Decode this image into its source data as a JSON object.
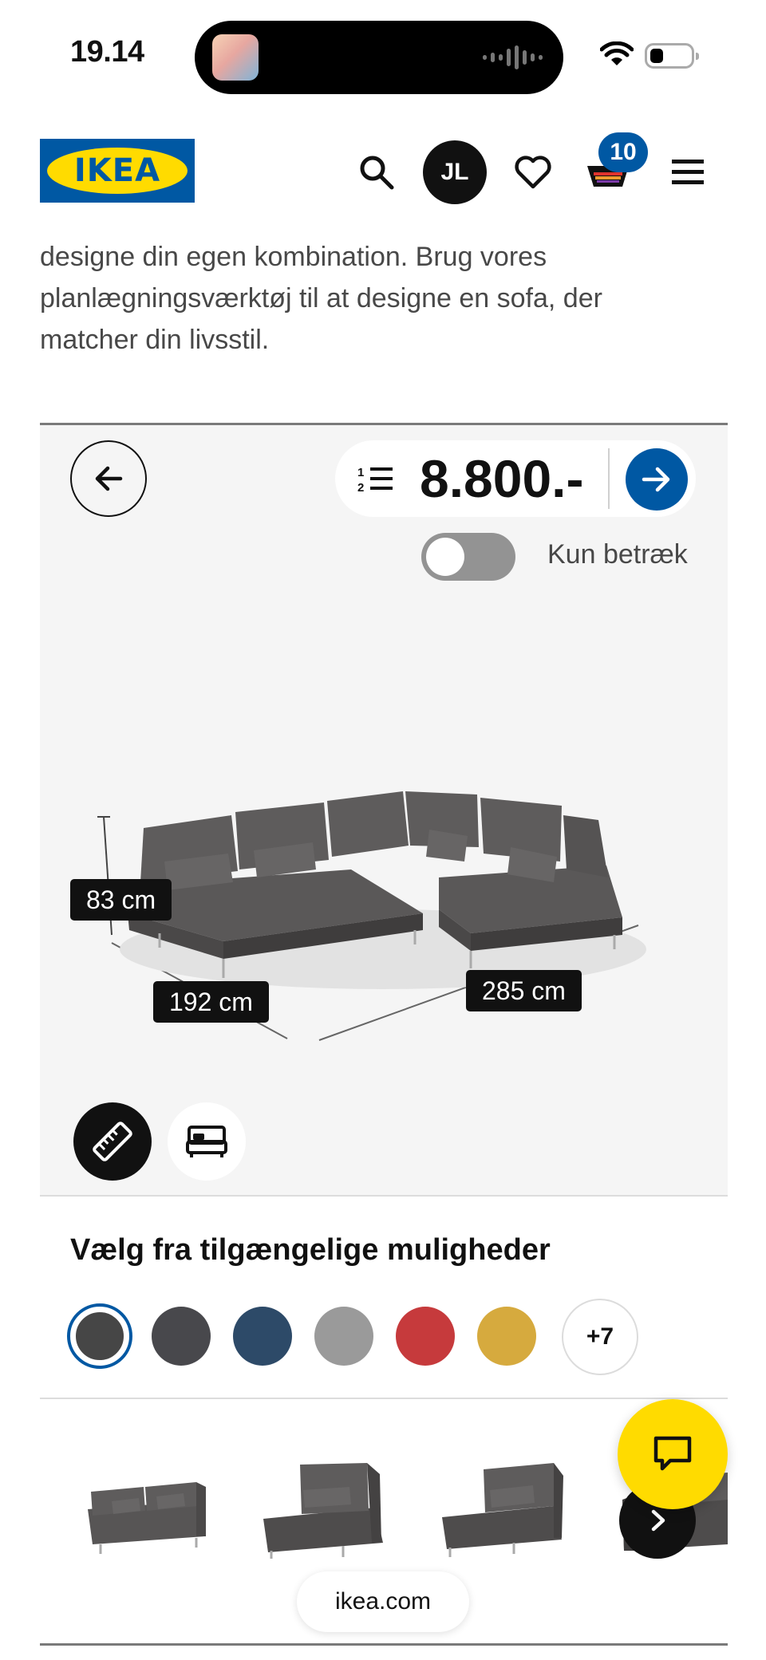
{
  "status_bar": {
    "time": "19.14"
  },
  "header": {
    "logo_text": "IKEA",
    "avatar_initials": "JL",
    "cart_count": "10",
    "brand_colors": {
      "blue": "#0058a3",
      "yellow": "#ffdb00"
    }
  },
  "intro_text": "designe din egen kombination. Brug vores planlægningsværktøj til at designe en sofa, der matcher din livsstil.",
  "configurator": {
    "price": "8.800.-",
    "toggle_label": "Kun betræk",
    "toggle_on": false,
    "dimensions": {
      "height": "83 cm",
      "depth": "192 cm",
      "width": "285 cm"
    },
    "view_buttons": [
      "ruler-icon",
      "bed-icon"
    ]
  },
  "options": {
    "title": "Vælg fra tilgængelige muligheder",
    "swatches": [
      {
        "color": "#464646",
        "selected": true
      },
      {
        "color": "#48484c",
        "selected": false
      },
      {
        "color": "#2d4a68",
        "selected": false
      },
      {
        "color": "#9a9a9a",
        "selected": false
      },
      {
        "color": "#c63a3c",
        "selected": false
      },
      {
        "color": "#d6aa3e",
        "selected": false
      }
    ],
    "more_label": "+7"
  },
  "modules": [
    "loveseat-module",
    "armchair-section-module",
    "chaise-section-module",
    "corner-section-module"
  ],
  "browser": {
    "url": "ikea.com"
  }
}
